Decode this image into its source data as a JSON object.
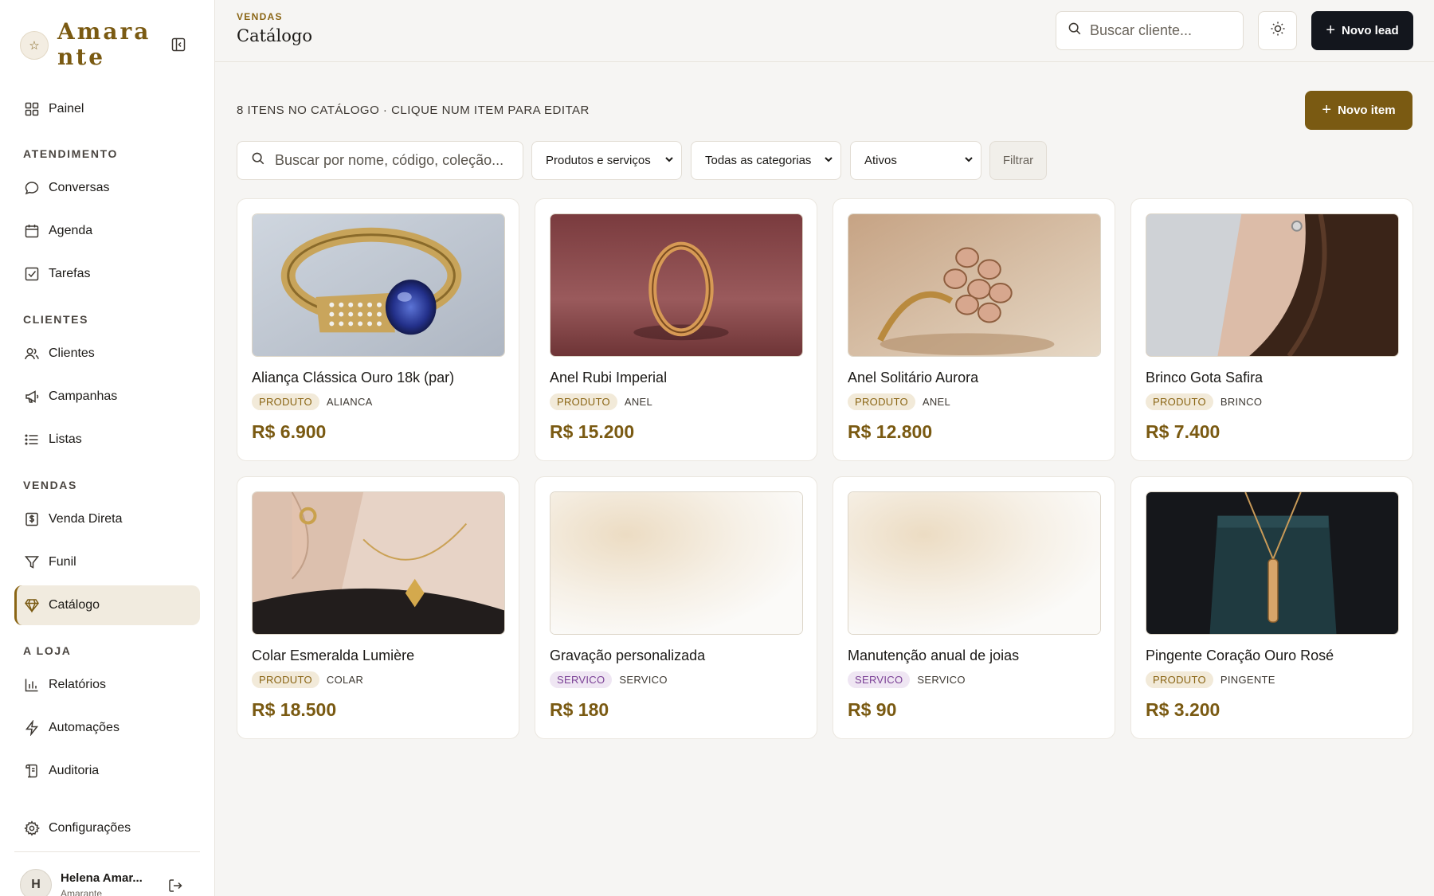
{
  "brand": {
    "name": "Amarante",
    "logo_icon": "star-icon"
  },
  "sidebar": {
    "items": [
      {
        "label": "Painel",
        "icon": "grid-icon"
      },
      {
        "label": "Conversas",
        "icon": "chat-bubble-icon"
      },
      {
        "label": "Agenda",
        "icon": "calendar-icon"
      },
      {
        "label": "Tarefas",
        "icon": "checkbox-icon"
      },
      {
        "label": "Clientes",
        "icon": "users-icon"
      },
      {
        "label": "Campanhas",
        "icon": "megaphone-icon"
      },
      {
        "label": "Listas",
        "icon": "list-icon"
      },
      {
        "label": "Venda Direta",
        "icon": "receipt-icon"
      },
      {
        "label": "Funil",
        "icon": "funnel-icon"
      },
      {
        "label": "Catálogo",
        "icon": "gem-icon",
        "active": true
      },
      {
        "label": "Relatórios",
        "icon": "bar-chart-icon"
      },
      {
        "label": "Automações",
        "icon": "lightning-icon"
      },
      {
        "label": "Auditoria",
        "icon": "audit-log-icon"
      },
      {
        "label": "Configurações",
        "icon": "gear-icon"
      }
    ],
    "sections": {
      "atendimento": "ATENDIMENTO",
      "clientes": "CLIENTES",
      "vendas": "VENDAS",
      "loja": "A LOJA"
    },
    "user": {
      "initial": "H",
      "name": "Helena Amar...",
      "subtitle": "Amarante"
    }
  },
  "header": {
    "breadcrumb": "VENDAS",
    "title": "Catálogo",
    "search_placeholder": "Buscar cliente...",
    "new_lead_label": "Novo lead"
  },
  "catalog": {
    "summary": "8 ITENS NO CATÁLOGO · CLIQUE NUM ITEM PARA EDITAR",
    "new_item_label": "Novo item",
    "search_placeholder": "Buscar por nome, código, coleção...",
    "filters": {
      "type": "Produtos e serviços",
      "category": "Todas as categorias",
      "status": "Ativos",
      "button": "Filtrar"
    },
    "items": [
      {
        "name": "Aliança Clássica Ouro 18k (par)",
        "type": "PRODUTO",
        "category": "ALIANCA",
        "price": "R$ 6.900",
        "image": "sapphire-gold-ring-photo"
      },
      {
        "name": "Anel Rubi Imperial",
        "type": "PRODUTO",
        "category": "ANEL",
        "price": "R$ 15.200",
        "image": "gold-band-ring-photo"
      },
      {
        "name": "Anel Solitário Aurora",
        "type": "PRODUTO",
        "category": "ANEL",
        "price": "R$ 12.800",
        "image": "rose-gold-cluster-ring-photo"
      },
      {
        "name": "Brinco Gota Safira",
        "type": "PRODUTO",
        "category": "BRINCO",
        "price": "R$ 7.400",
        "image": "earring-model-photo"
      },
      {
        "name": "Colar Esmeralda Lumière",
        "type": "PRODUTO",
        "category": "COLAR",
        "price": "R$ 18.500",
        "image": "necklace-model-photo"
      },
      {
        "name": "Gravação personalizada",
        "type": "SERVICO",
        "category": "SERVICO",
        "price": "R$ 180",
        "image": "placeholder-gradient"
      },
      {
        "name": "Manutenção anual de joias",
        "type": "SERVICO",
        "category": "SERVICO",
        "price": "R$ 90",
        "image": "placeholder-gradient"
      },
      {
        "name": "Pingente Coração Ouro Rosé",
        "type": "PRODUTO",
        "category": "PINGENTE",
        "price": "R$ 3.200",
        "image": "pendant-box-photo"
      }
    ]
  },
  "colors": {
    "accent": "#7a5a12",
    "dark_button": "#13161d",
    "produto_tag_bg": "#f2ead9",
    "servico_tag_bg": "#efe6f3",
    "active_nav_bg": "#f1ebdf"
  }
}
